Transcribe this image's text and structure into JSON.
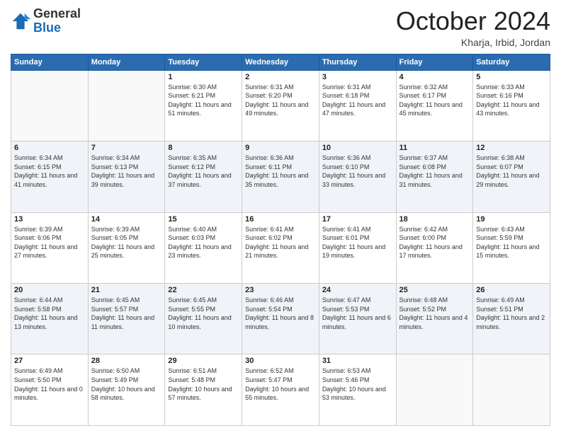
{
  "header": {
    "logo_general": "General",
    "logo_blue": "Blue",
    "month_title": "October 2024",
    "location": "Kharja, Irbid, Jordan"
  },
  "weekdays": [
    "Sunday",
    "Monday",
    "Tuesday",
    "Wednesday",
    "Thursday",
    "Friday",
    "Saturday"
  ],
  "weeks": [
    [
      {
        "day": "",
        "sunrise": "",
        "sunset": "",
        "daylight": ""
      },
      {
        "day": "",
        "sunrise": "",
        "sunset": "",
        "daylight": ""
      },
      {
        "day": "1",
        "sunrise": "Sunrise: 6:30 AM",
        "sunset": "Sunset: 6:21 PM",
        "daylight": "Daylight: 11 hours and 51 minutes."
      },
      {
        "day": "2",
        "sunrise": "Sunrise: 6:31 AM",
        "sunset": "Sunset: 6:20 PM",
        "daylight": "Daylight: 11 hours and 49 minutes."
      },
      {
        "day": "3",
        "sunrise": "Sunrise: 6:31 AM",
        "sunset": "Sunset: 6:18 PM",
        "daylight": "Daylight: 11 hours and 47 minutes."
      },
      {
        "day": "4",
        "sunrise": "Sunrise: 6:32 AM",
        "sunset": "Sunset: 6:17 PM",
        "daylight": "Daylight: 11 hours and 45 minutes."
      },
      {
        "day": "5",
        "sunrise": "Sunrise: 6:33 AM",
        "sunset": "Sunset: 6:16 PM",
        "daylight": "Daylight: 11 hours and 43 minutes."
      }
    ],
    [
      {
        "day": "6",
        "sunrise": "Sunrise: 6:34 AM",
        "sunset": "Sunset: 6:15 PM",
        "daylight": "Daylight: 11 hours and 41 minutes."
      },
      {
        "day": "7",
        "sunrise": "Sunrise: 6:34 AM",
        "sunset": "Sunset: 6:13 PM",
        "daylight": "Daylight: 11 hours and 39 minutes."
      },
      {
        "day": "8",
        "sunrise": "Sunrise: 6:35 AM",
        "sunset": "Sunset: 6:12 PM",
        "daylight": "Daylight: 11 hours and 37 minutes."
      },
      {
        "day": "9",
        "sunrise": "Sunrise: 6:36 AM",
        "sunset": "Sunset: 6:11 PM",
        "daylight": "Daylight: 11 hours and 35 minutes."
      },
      {
        "day": "10",
        "sunrise": "Sunrise: 6:36 AM",
        "sunset": "Sunset: 6:10 PM",
        "daylight": "Daylight: 11 hours and 33 minutes."
      },
      {
        "day": "11",
        "sunrise": "Sunrise: 6:37 AM",
        "sunset": "Sunset: 6:08 PM",
        "daylight": "Daylight: 11 hours and 31 minutes."
      },
      {
        "day": "12",
        "sunrise": "Sunrise: 6:38 AM",
        "sunset": "Sunset: 6:07 PM",
        "daylight": "Daylight: 11 hours and 29 minutes."
      }
    ],
    [
      {
        "day": "13",
        "sunrise": "Sunrise: 6:39 AM",
        "sunset": "Sunset: 6:06 PM",
        "daylight": "Daylight: 11 hours and 27 minutes."
      },
      {
        "day": "14",
        "sunrise": "Sunrise: 6:39 AM",
        "sunset": "Sunset: 6:05 PM",
        "daylight": "Daylight: 11 hours and 25 minutes."
      },
      {
        "day": "15",
        "sunrise": "Sunrise: 6:40 AM",
        "sunset": "Sunset: 6:03 PM",
        "daylight": "Daylight: 11 hours and 23 minutes."
      },
      {
        "day": "16",
        "sunrise": "Sunrise: 6:41 AM",
        "sunset": "Sunset: 6:02 PM",
        "daylight": "Daylight: 11 hours and 21 minutes."
      },
      {
        "day": "17",
        "sunrise": "Sunrise: 6:41 AM",
        "sunset": "Sunset: 6:01 PM",
        "daylight": "Daylight: 11 hours and 19 minutes."
      },
      {
        "day": "18",
        "sunrise": "Sunrise: 6:42 AM",
        "sunset": "Sunset: 6:00 PM",
        "daylight": "Daylight: 11 hours and 17 minutes."
      },
      {
        "day": "19",
        "sunrise": "Sunrise: 6:43 AM",
        "sunset": "Sunset: 5:59 PM",
        "daylight": "Daylight: 11 hours and 15 minutes."
      }
    ],
    [
      {
        "day": "20",
        "sunrise": "Sunrise: 6:44 AM",
        "sunset": "Sunset: 5:58 PM",
        "daylight": "Daylight: 11 hours and 13 minutes."
      },
      {
        "day": "21",
        "sunrise": "Sunrise: 6:45 AM",
        "sunset": "Sunset: 5:57 PM",
        "daylight": "Daylight: 11 hours and 11 minutes."
      },
      {
        "day": "22",
        "sunrise": "Sunrise: 6:45 AM",
        "sunset": "Sunset: 5:55 PM",
        "daylight": "Daylight: 11 hours and 10 minutes."
      },
      {
        "day": "23",
        "sunrise": "Sunrise: 6:46 AM",
        "sunset": "Sunset: 5:54 PM",
        "daylight": "Daylight: 11 hours and 8 minutes."
      },
      {
        "day": "24",
        "sunrise": "Sunrise: 6:47 AM",
        "sunset": "Sunset: 5:53 PM",
        "daylight": "Daylight: 11 hours and 6 minutes."
      },
      {
        "day": "25",
        "sunrise": "Sunrise: 6:48 AM",
        "sunset": "Sunset: 5:52 PM",
        "daylight": "Daylight: 11 hours and 4 minutes."
      },
      {
        "day": "26",
        "sunrise": "Sunrise: 6:49 AM",
        "sunset": "Sunset: 5:51 PM",
        "daylight": "Daylight: 11 hours and 2 minutes."
      }
    ],
    [
      {
        "day": "27",
        "sunrise": "Sunrise: 6:49 AM",
        "sunset": "Sunset: 5:50 PM",
        "daylight": "Daylight: 11 hours and 0 minutes."
      },
      {
        "day": "28",
        "sunrise": "Sunrise: 6:50 AM",
        "sunset": "Sunset: 5:49 PM",
        "daylight": "Daylight: 10 hours and 58 minutes."
      },
      {
        "day": "29",
        "sunrise": "Sunrise: 6:51 AM",
        "sunset": "Sunset: 5:48 PM",
        "daylight": "Daylight: 10 hours and 57 minutes."
      },
      {
        "day": "30",
        "sunrise": "Sunrise: 6:52 AM",
        "sunset": "Sunset: 5:47 PM",
        "daylight": "Daylight: 10 hours and 55 minutes."
      },
      {
        "day": "31",
        "sunrise": "Sunrise: 6:53 AM",
        "sunset": "Sunset: 5:46 PM",
        "daylight": "Daylight: 10 hours and 53 minutes."
      },
      {
        "day": "",
        "sunrise": "",
        "sunset": "",
        "daylight": ""
      },
      {
        "day": "",
        "sunrise": "",
        "sunset": "",
        "daylight": ""
      }
    ]
  ]
}
